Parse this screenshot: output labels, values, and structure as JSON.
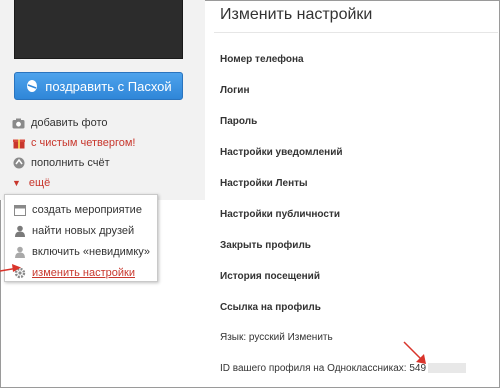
{
  "sidebar": {
    "congrats_button": "поздравить с Пасхой",
    "items": [
      {
        "label": "добавить фото",
        "icon": "camera-icon"
      },
      {
        "label": "с чистым четвергом!",
        "icon": "gift-icon"
      },
      {
        "label": "пополнить счёт",
        "icon": "coin-icon"
      }
    ],
    "more_label": "ещё",
    "dropdown": [
      {
        "label": "создать мероприятие",
        "icon": "calendar-icon"
      },
      {
        "label": "найти новых друзей",
        "icon": "user-icon"
      },
      {
        "label": "включить «невидимку»",
        "icon": "invisible-icon"
      },
      {
        "label": "изменить настройки",
        "icon": "gear-icon"
      }
    ]
  },
  "main": {
    "title": "Изменить настройки",
    "settings": [
      "Номер телефона",
      "Логин",
      "Пароль",
      "Настройки уведомлений",
      "Настройки Ленты",
      "Настройки публичности",
      "Закрыть профиль",
      "История посещений",
      "Ссылка на профиль"
    ],
    "language_label": "Язык: русский",
    "language_change": "Изменить",
    "profile_id_label": "ID вашего профиля на Одноклассниках: 549"
  },
  "colors": {
    "accent_red": "#c8372d",
    "button_blue": "#3a8fde"
  }
}
